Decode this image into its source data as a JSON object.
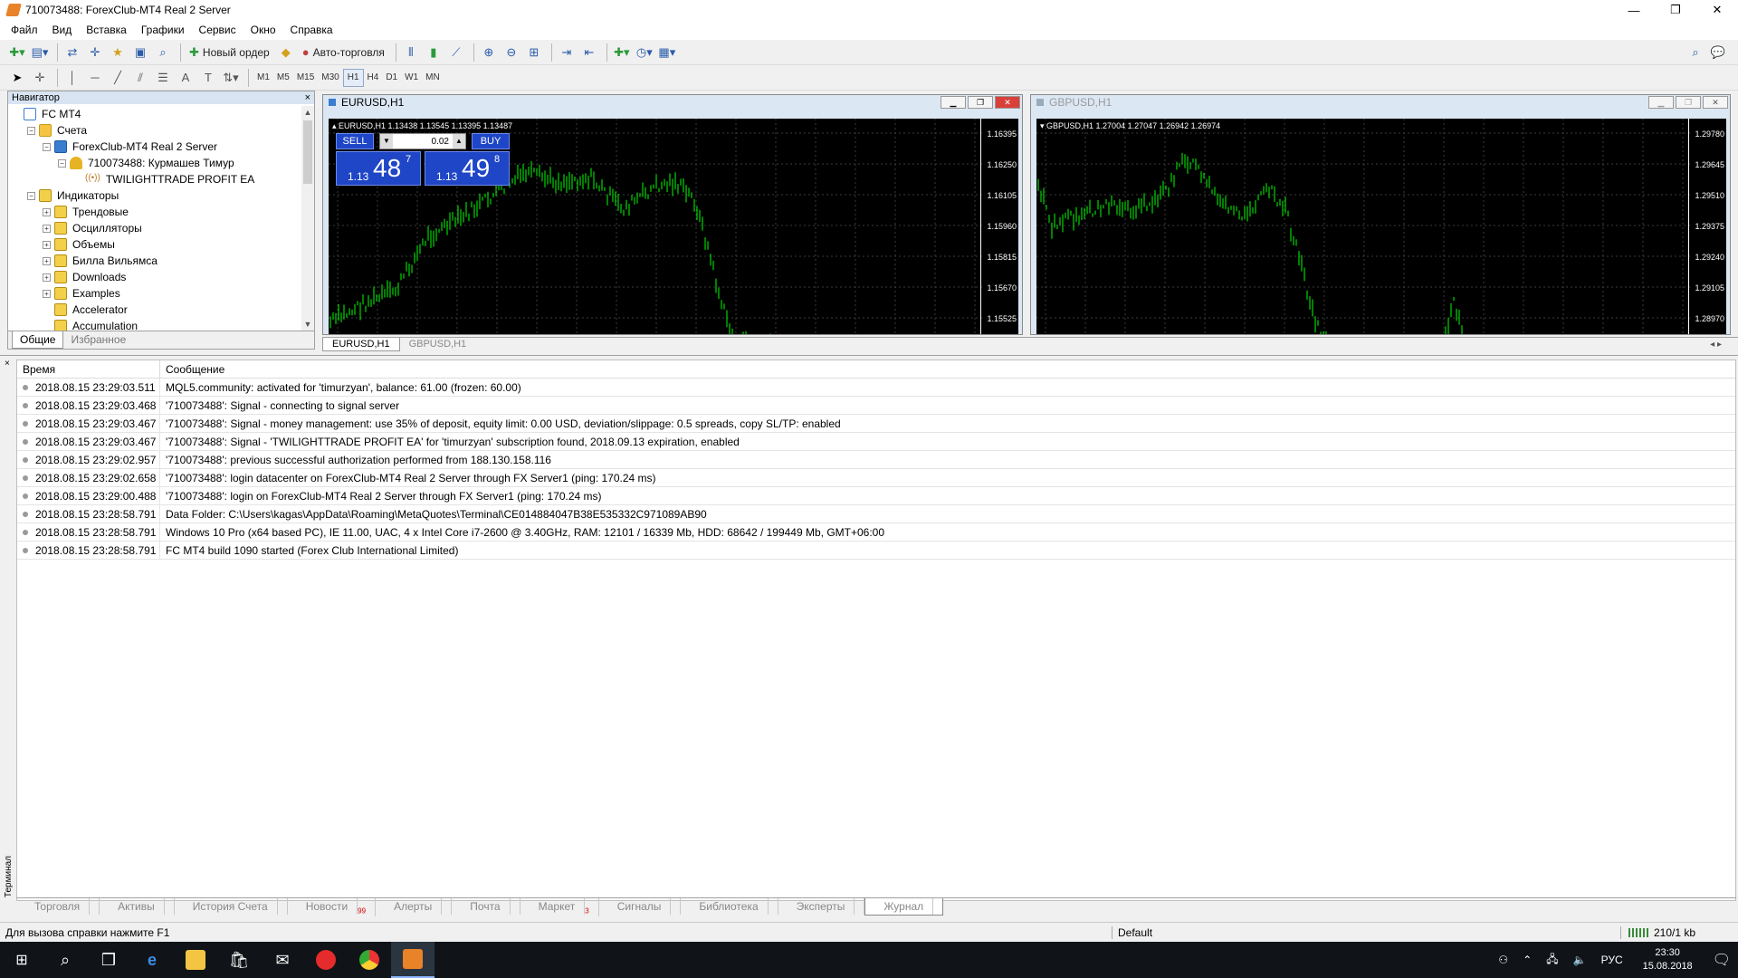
{
  "window": {
    "title": "710073488: ForexClub-MT4 Real 2 Server",
    "min": "—",
    "max": "❐",
    "close": "✕"
  },
  "menu": [
    "Файл",
    "Вид",
    "Вставка",
    "Графики",
    "Сервис",
    "Окно",
    "Справка"
  ],
  "toolbar": {
    "new_order": "Новый ордер",
    "auto_trading": "Авто-торговля"
  },
  "timeframes": [
    "M1",
    "M5",
    "M15",
    "M30",
    "H1",
    "H4",
    "D1",
    "W1",
    "MN"
  ],
  "active_timeframe": "H1",
  "navigator": {
    "title": "Навигатор",
    "close": "×",
    "tree": [
      {
        "label": "FC MT4",
        "level": 0,
        "icon": "root",
        "exp": ""
      },
      {
        "label": "Счета",
        "level": 1,
        "icon": "folder",
        "exp": "−"
      },
      {
        "label": "ForexClub-MT4 Real 2 Server",
        "level": 2,
        "icon": "acc",
        "exp": "−"
      },
      {
        "label": "710073488: Курмашев Тимур",
        "level": 3,
        "icon": "user",
        "exp": "−"
      },
      {
        "label": "TWILIGHTTRADE PROFIT EA",
        "level": 4,
        "icon": "ea",
        "exp": ""
      },
      {
        "label": "Индикаторы",
        "level": 1,
        "icon": "ind",
        "exp": "−"
      },
      {
        "label": "Трендовые",
        "level": 2,
        "icon": "ind",
        "exp": "+"
      },
      {
        "label": "Осцилляторы",
        "level": 2,
        "icon": "ind",
        "exp": "+"
      },
      {
        "label": "Объемы",
        "level": 2,
        "icon": "ind",
        "exp": "+"
      },
      {
        "label": "Билла Вильямса",
        "level": 2,
        "icon": "ind",
        "exp": "+"
      },
      {
        "label": "Downloads",
        "level": 2,
        "icon": "ind",
        "exp": "+"
      },
      {
        "label": "Examples",
        "level": 2,
        "icon": "ind",
        "exp": "+"
      },
      {
        "label": "Accelerator",
        "level": 2,
        "icon": "ind",
        "exp": ""
      },
      {
        "label": "Accumulation",
        "level": 2,
        "icon": "ind",
        "exp": ""
      }
    ],
    "tabs": [
      "Общие",
      "Избранное"
    ]
  },
  "charts": {
    "eurusd": {
      "title": "EURUSD,H1",
      "info": "EURUSD,H1  1.13438 1.13545 1.13395 1.13487",
      "prices": [
        "1.16395",
        "1.16250",
        "1.16105",
        "1.15960",
        "1.15815",
        "1.15670",
        "1.15525"
      ],
      "one_click": {
        "sell": "SELL",
        "buy": "BUY",
        "lot": "0.02",
        "sell_small": "1.13",
        "sell_big": "48",
        "sell_sup": "7",
        "buy_small": "1.13",
        "buy_big": "49",
        "buy_sup": "8"
      }
    },
    "gbpusd": {
      "title": "GBPUSD,H1",
      "info": "GBPUSD,H1  1.27004 1.27047 1.26942 1.26974",
      "prices": [
        "1.29780",
        "1.29645",
        "1.29510",
        "1.29375",
        "1.29240",
        "1.29105",
        "1.28970"
      ]
    },
    "tabs": [
      "EURUSD,H1",
      "GBPUSD,H1"
    ],
    "arrows": "◂  ▸"
  },
  "terminal": {
    "side_label": "Терминал",
    "close": "×",
    "columns": [
      "Время",
      "Сообщение"
    ],
    "rows": [
      {
        "time": "2018.08.15 23:29:03.511",
        "msg": "MQL5.community: activated for 'timurzyan', balance: 61.00 (frozen: 60.00)"
      },
      {
        "time": "2018.08.15 23:29:03.468",
        "msg": "'710073488': Signal - connecting to signal server"
      },
      {
        "time": "2018.08.15 23:29:03.467",
        "msg": "'710073488': Signal - money management: use 35% of deposit, equity limit: 0.00 USD, deviation/slippage: 0.5 spreads, copy SL/TP: enabled"
      },
      {
        "time": "2018.08.15 23:29:03.467",
        "msg": "'710073488': Signal - 'TWILIGHTTRADE PROFIT EA' for 'timurzyan' subscription found, 2018.09.13 expiration, enabled"
      },
      {
        "time": "2018.08.15 23:29:02.957",
        "msg": "'710073488': previous successful authorization performed from 188.130.158.116"
      },
      {
        "time": "2018.08.15 23:29:02.658",
        "msg": "'710073488': login datacenter on ForexClub-MT4 Real 2 Server through FX Server1 (ping: 170.24 ms)"
      },
      {
        "time": "2018.08.15 23:29:00.488",
        "msg": "'710073488': login on ForexClub-MT4 Real 2 Server through FX Server1 (ping: 170.24 ms)"
      },
      {
        "time": "2018.08.15 23:28:58.791",
        "msg": "Data Folder: C:\\Users\\kagas\\AppData\\Roaming\\MetaQuotes\\Terminal\\CE014884047B38E535332C971089AB90"
      },
      {
        "time": "2018.08.15 23:28:58.791",
        "msg": "Windows 10 Pro (x64 based PC), IE 11.00, UAC, 4 x Intel Core i7-2600  @ 3.40GHz, RAM: 12101 / 16339 Mb, HDD: 68642 / 199449 Mb, GMT+06:00"
      },
      {
        "time": "2018.08.15 23:28:58.791",
        "msg": "FC MT4 build 1090 started (Forex Club International Limited)"
      }
    ],
    "tabs": [
      {
        "label": "Торговля"
      },
      {
        "label": "Активы"
      },
      {
        "label": "История Счета"
      },
      {
        "label": "Новости",
        "badge": "99"
      },
      {
        "label": "Алерты"
      },
      {
        "label": "Почта"
      },
      {
        "label": "Маркет",
        "badge": "3"
      },
      {
        "label": "Сигналы"
      },
      {
        "label": "Библиотека"
      },
      {
        "label": "Эксперты"
      },
      {
        "label": "Журнал",
        "active": true
      }
    ]
  },
  "status": {
    "help": "Для вызова справки нажмите F1",
    "profile": "Default",
    "traffic": "210/1 kb"
  },
  "taskbar": {
    "lang": "РУС",
    "time": "23:30",
    "date": "15.08.2018"
  },
  "colors": {
    "candle": "#00ff00",
    "chart_bg": "#000000",
    "oneclick": "#1f46c6"
  }
}
